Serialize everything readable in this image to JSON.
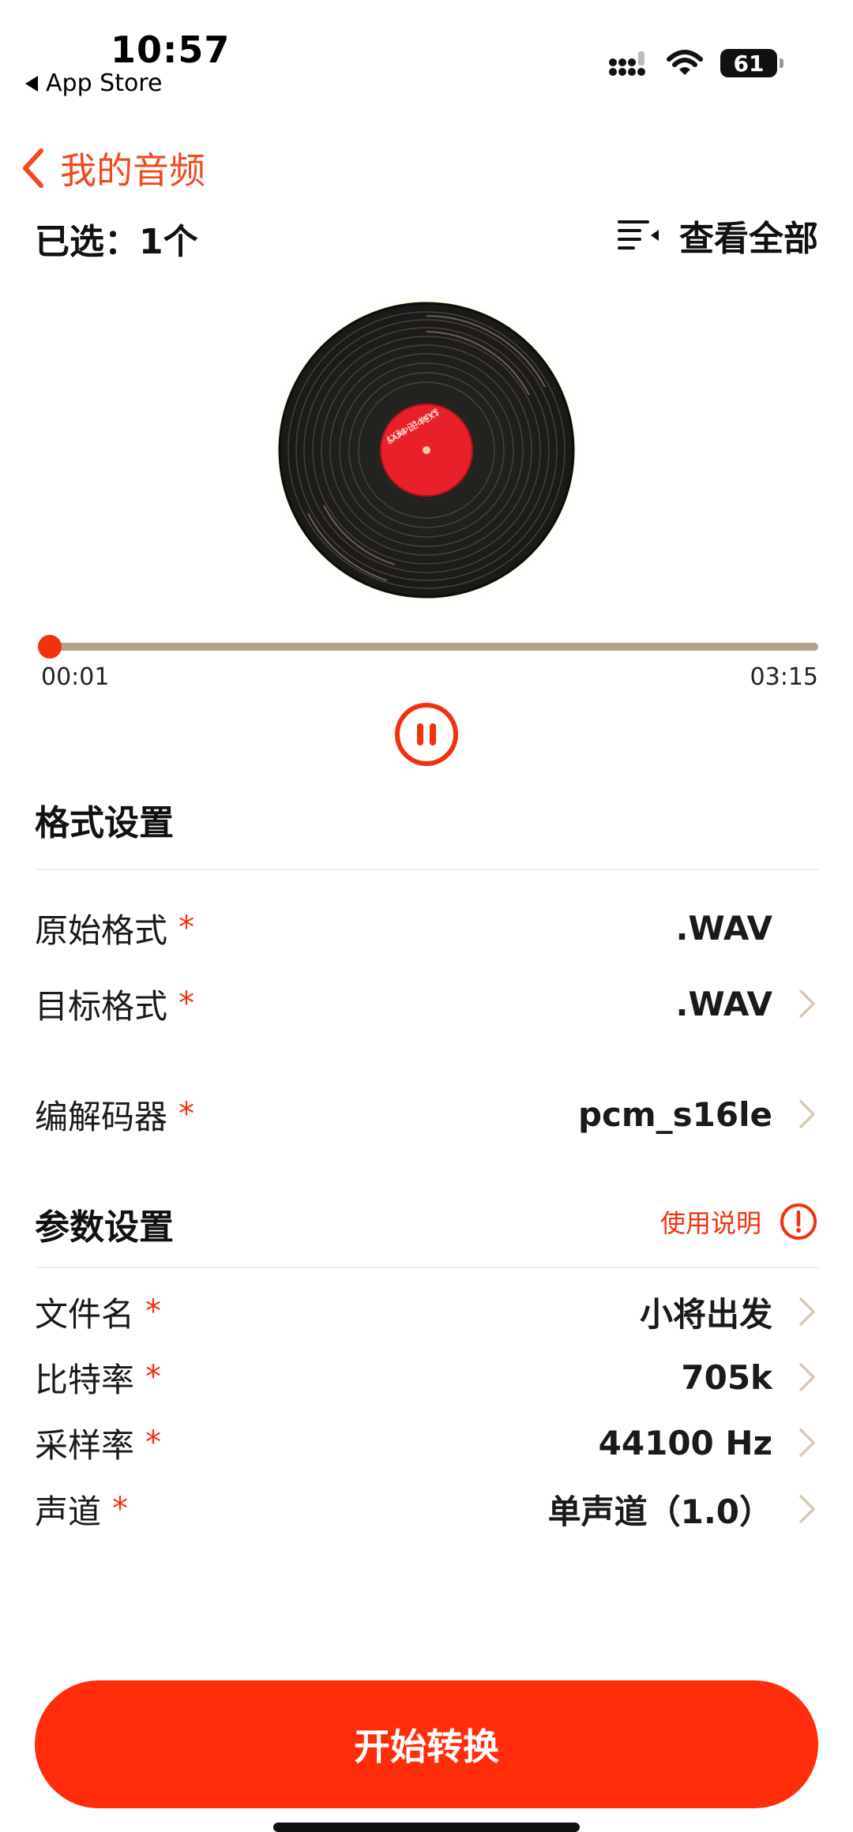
{
  "status_bar": {
    "time": "10:57",
    "back_app": "App Store",
    "battery": "61"
  },
  "nav": {
    "title": "我的音频"
  },
  "selection": {
    "label": "已选：1个",
    "view_all": "查看全部"
  },
  "player": {
    "disc_label": "SAMPLE TEXT",
    "current_time": "00:01",
    "total_time": "03:15",
    "progress": 0.005,
    "state": "playing"
  },
  "format_settings": {
    "title": "格式设置",
    "rows": [
      {
        "label": "原始格式",
        "value": ".WAV",
        "required": "*",
        "has_chevron": false
      },
      {
        "label": "目标格式",
        "value": ".WAV",
        "required": "*",
        "has_chevron": true
      },
      {
        "label": "编解码器",
        "value": "pcm_s16le",
        "required": "*",
        "has_chevron": true
      }
    ]
  },
  "param_settings": {
    "title": "参数设置",
    "help_label": "使用说明",
    "rows": [
      {
        "label": "文件名",
        "value": "小将出发",
        "required": "*"
      },
      {
        "label": "比特率",
        "value": "705k",
        "required": "*"
      },
      {
        "label": "采样率",
        "value": "44100 Hz",
        "required": "*"
      },
      {
        "label": "声道",
        "value": "单声道（1.0）",
        "required": "*"
      }
    ]
  },
  "actions": {
    "start_label": "开始转换"
  },
  "colors": {
    "accent": "#f0320f",
    "button": "#ff2d0a",
    "track": "#b3a08a",
    "chevron": "#d9c9b4"
  }
}
